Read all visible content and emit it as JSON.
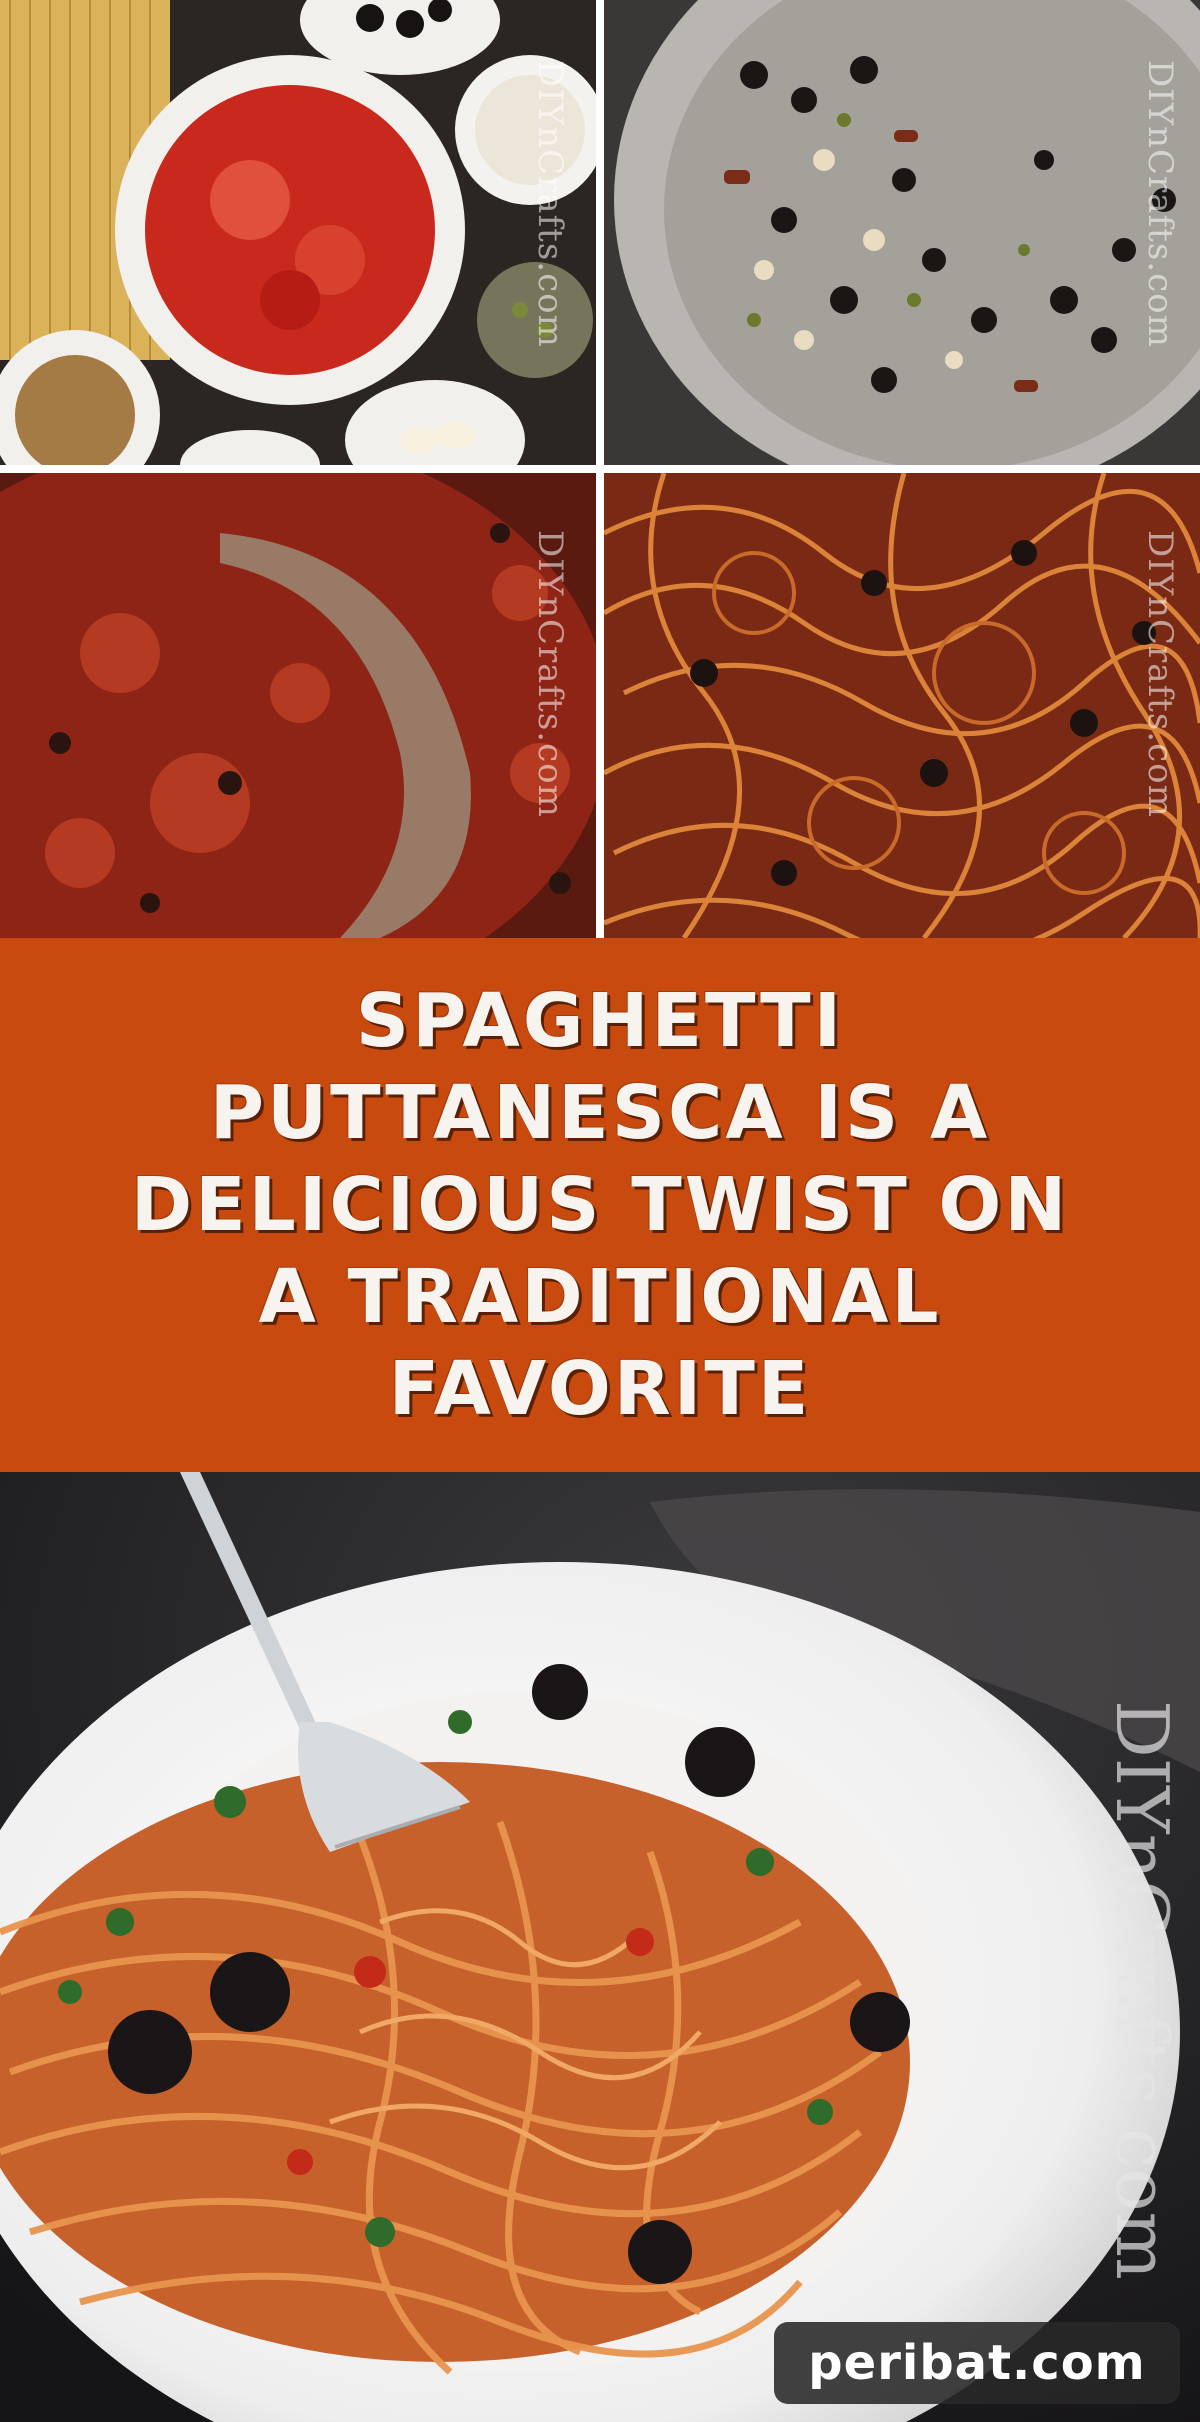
{
  "banner": {
    "lines": [
      "SPAGHETTI",
      "PUTTANESCA IS A",
      "DELICIOUS TWIST ON",
      "A TRADITIONAL",
      "FAVORITE"
    ]
  },
  "watermarks": {
    "tile": "DIYnCrafts.com",
    "hero": "DIYnCrafts.com"
  },
  "badge": {
    "text": "peribat.com"
  },
  "colors": {
    "banner_bg": "#c84a0f",
    "banner_text": "#f7f3ee",
    "badge_bg": "#282828"
  }
}
